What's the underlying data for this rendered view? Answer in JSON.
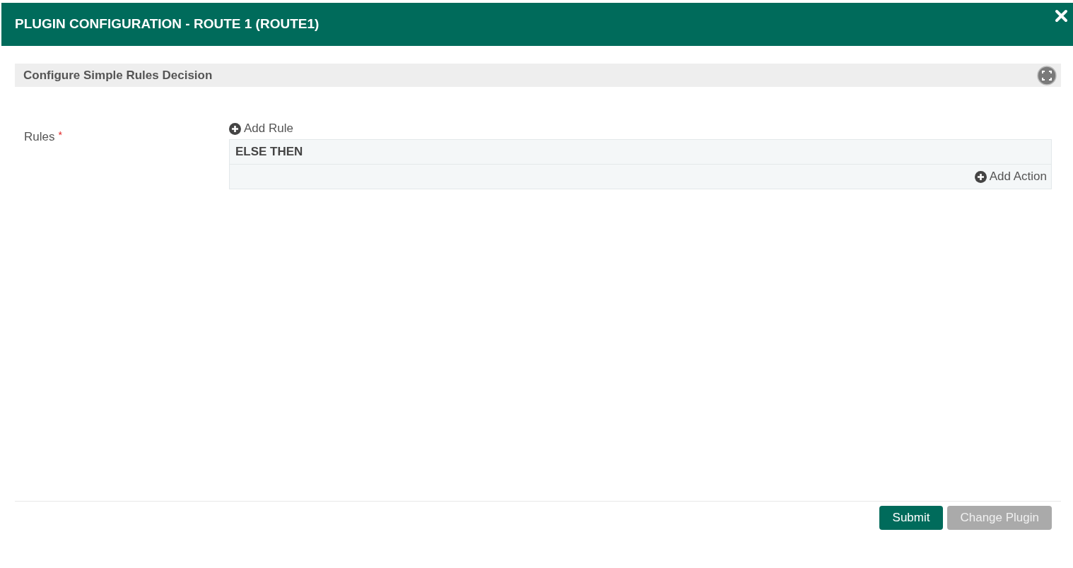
{
  "dialog": {
    "title": "PLUGIN CONFIGURATION - ROUTE 1 (ROUTE1)"
  },
  "section": {
    "title": "Configure Simple Rules Decision"
  },
  "rules_field": {
    "label": "Rules",
    "required_mark": "*",
    "add_rule": "Add Rule",
    "else_block": {
      "heading": "ELSE THEN",
      "add_action": "Add Action"
    }
  },
  "buttons": [
    {
      "label": "Submit",
      "disabled": false
    },
    {
      "label": "Change Plugin",
      "disabled": true
    }
  ]
}
